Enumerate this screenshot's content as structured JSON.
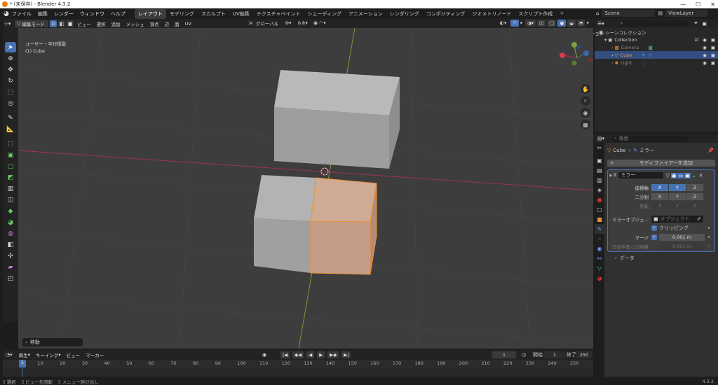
{
  "window": {
    "title": "* (未保存) - Blender 4.3.2",
    "min": "—",
    "max": "☐",
    "close": "✕"
  },
  "menu": [
    "ファイル",
    "編集",
    "レンダー",
    "ウィンドウ",
    "ヘルプ"
  ],
  "workspaces": [
    "レイアウト",
    "モデリング",
    "スカルプト",
    "UV編集",
    "テクスチャペイント",
    "シェーディング",
    "アニメーション",
    "レンダリング",
    "コンポジティング",
    "ジオメトリノード",
    "スクリプト作成"
  ],
  "workspace_add": "+",
  "scene": {
    "label": "Scene",
    "viewlayer": "ViewLayer"
  },
  "vpheader": {
    "mode": "編集モード",
    "menus": [
      "ビュー",
      "選択",
      "追加",
      "メッシュ",
      "頂点",
      "辺",
      "面",
      "UV"
    ],
    "orientation": "グローバル",
    "xyz": [
      "X",
      "Y",
      "Z"
    ],
    "options": "オプション"
  },
  "viewport": {
    "view_name": "ユーザー・平行投影",
    "object_name": "(1) Cube"
  },
  "operator_status": "移動",
  "timeline": {
    "menus": [
      "再生",
      "キーイング",
      "ビュー",
      "マーカー"
    ],
    "current": "1",
    "start_label": "開始",
    "start": "1",
    "end_label": "終了",
    "end": "250",
    "ticks": [
      "1",
      "10",
      "20",
      "30",
      "40",
      "50",
      "60",
      "70",
      "80",
      "90",
      "100",
      "110",
      "120",
      "130",
      "140",
      "150",
      "160",
      "170",
      "180",
      "190",
      "200",
      "210",
      "220",
      "230",
      "240",
      "250"
    ]
  },
  "statusbar": {
    "items": [
      "選択",
      "ビューを回転",
      "メニュー呼び出し"
    ],
    "version": "4.3.2"
  },
  "outliner": {
    "search_placeholder": "",
    "root": "シーンコレクション",
    "collection": "Collection",
    "objects": [
      "Camera",
      "Cube",
      "Light"
    ]
  },
  "properties": {
    "search_placeholder": "検索",
    "breadcrumb_object": "Cube",
    "breadcrumb_modifier": "ミラー",
    "add_modifier": "モディファイアーを追加",
    "modifier_name": "ミラー",
    "axis_label": "座標軸",
    "bisect_label": "二分割",
    "flip_label": "反転",
    "axes": [
      "X",
      "Y",
      "Z"
    ],
    "mirror_object_label": "ミラーオブジェ...",
    "mirror_object_placeholder": "オブジェクト",
    "clipping_label": "クリッピング",
    "merge_label": "マージ",
    "merge_value": "0.001 m",
    "bisect_dist_label": "分割平面との距離",
    "bisect_dist_value": "0.001 m",
    "data_label": "データ"
  },
  "colors": {
    "accent": "#4772b3",
    "selected_orange": "#e8923a",
    "x_axis": "#a6334a",
    "y_axis": "#7ea13a"
  }
}
